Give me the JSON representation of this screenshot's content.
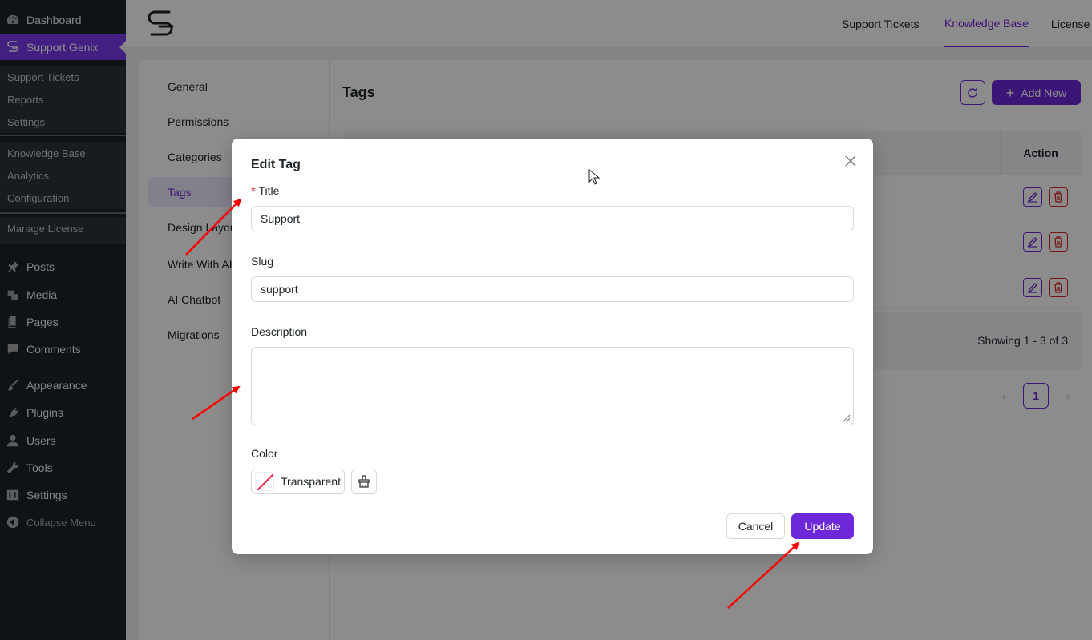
{
  "wp_menu": {
    "dashboard": "Dashboard",
    "support_genix": "Support Genix",
    "sub1": [
      "Support Tickets",
      "Reports",
      "Settings"
    ],
    "sub2": [
      "Knowledge Base",
      "Analytics",
      "Configuration"
    ],
    "sub3": [
      "Manage License"
    ],
    "items": [
      "Posts",
      "Media",
      "Pages",
      "Comments",
      "Appearance",
      "Plugins",
      "Users",
      "Tools",
      "Settings"
    ],
    "collapse": "Collapse Menu"
  },
  "topnav": {
    "support_tickets": "Support Tickets",
    "knowledge_base": "Knowledge Base",
    "license": "License"
  },
  "settings_nav": [
    "General",
    "Permissions",
    "Categories",
    "Tags",
    "Design Layout",
    "Write With AI",
    "AI Chatbot",
    "Migrations"
  ],
  "tags_page": {
    "title": "Tags",
    "add_new": "Add New",
    "action_header": "Action",
    "showing": "Showing 1 - 3 of 3",
    "page": "1"
  },
  "modal": {
    "title": "Edit Tag",
    "title_label": "Title",
    "title_value": "Support",
    "slug_label": "Slug",
    "slug_value": "support",
    "description_label": "Description",
    "description_value": "",
    "color_label": "Color",
    "color_value": "Transparent",
    "cancel": "Cancel",
    "update": "Update"
  },
  "colors": {
    "brand": "#6d28d9",
    "wp_sidebar": "#1d2327",
    "danger": "#dc2626",
    "annotation": "#ff0000"
  }
}
